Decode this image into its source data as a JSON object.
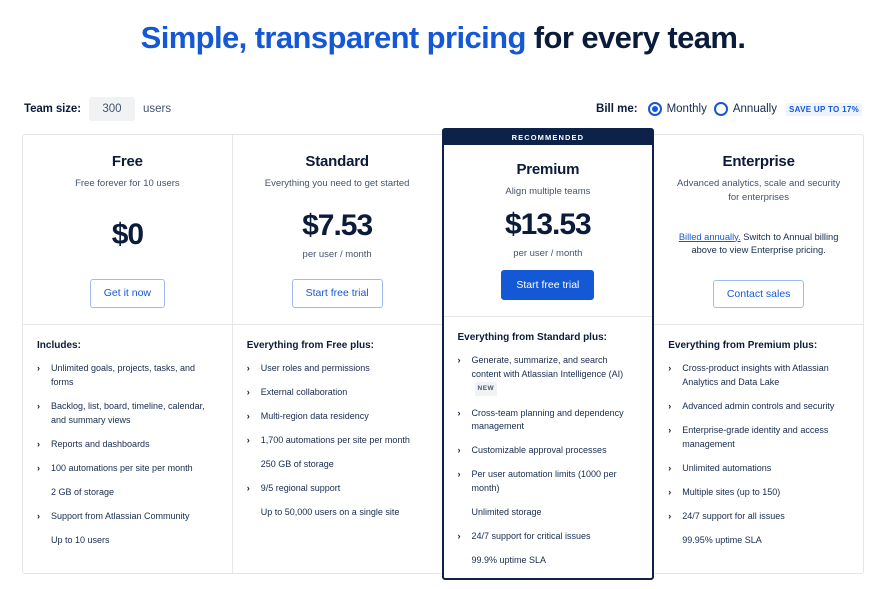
{
  "hero": {
    "accent_text": "Simple, transparent pricing",
    "rest_text": " for every team."
  },
  "controls": {
    "team_size_label": "Team size:",
    "team_size_value": "300",
    "team_size_placeholder": "300",
    "team_size_units": "users",
    "bill_me_label": "Bill me:",
    "monthly_label": "Monthly",
    "annually_label": "Annually",
    "save_badge": "SAVE UP TO 17%"
  },
  "colors": {
    "accent_blue": "#1558d6",
    "navy": "#0c2249",
    "border": "#e4e6ea",
    "muted_text": "#44546f"
  },
  "plans": [
    {
      "name": "Free",
      "tagline": "Free forever for 10 users",
      "price": "$0",
      "price_sub": "",
      "cta_label": "Get it now",
      "cta_style": "outline",
      "ribbon": "",
      "features_title": "Includes:",
      "features": [
        {
          "text": "Unlimited goals, projects, tasks, and forms",
          "chevron": true
        },
        {
          "text": "Backlog, list, board, timeline, calendar, and summary views",
          "chevron": true
        },
        {
          "text": "Reports and dashboards",
          "chevron": true
        },
        {
          "text": "100 automations per site per month",
          "chevron": true
        },
        {
          "text": "2 GB of storage",
          "chevron": false
        },
        {
          "text": "Support from Atlassian Community",
          "chevron": true
        },
        {
          "text": "Up to 10 users",
          "chevron": false
        }
      ]
    },
    {
      "name": "Standard",
      "tagline": "Everything you need to get started",
      "price": "$7.53",
      "price_sub": "per user / month",
      "cta_label": "Start free trial",
      "cta_style": "outline",
      "ribbon": "",
      "features_title": "Everything from Free plus:",
      "features": [
        {
          "text": "User roles and permissions",
          "chevron": true
        },
        {
          "text": "External collaboration",
          "chevron": true
        },
        {
          "text": "Multi-region data residency",
          "chevron": true
        },
        {
          "text": "1,700 automations per site per month",
          "chevron": true
        },
        {
          "text": "250 GB of storage",
          "chevron": false
        },
        {
          "text": "9/5 regional support",
          "chevron": true
        },
        {
          "text": "Up to 50,000 users on a single site",
          "chevron": false
        }
      ]
    },
    {
      "name": "Premium",
      "tagline": "Align multiple teams",
      "price": "$13.53",
      "price_sub": "per user / month",
      "cta_label": "Start free trial",
      "cta_style": "solid",
      "ribbon": "RECOMMENDED",
      "features_title": "Everything from Standard plus:",
      "features": [
        {
          "text": "Generate, summarize, and search content with Atlassian Intelligence (AI)",
          "chevron": true,
          "badge": "NEW"
        },
        {
          "text": "Cross-team planning and dependency management",
          "chevron": true
        },
        {
          "text": "Customizable approval processes",
          "chevron": true
        },
        {
          "text": "Per user automation limits (1000 per month)",
          "chevron": true
        },
        {
          "text": "Unlimited storage",
          "chevron": false
        },
        {
          "text": "24/7 support for critical issues",
          "chevron": true
        },
        {
          "text": "99.9% uptime SLA",
          "chevron": false
        }
      ]
    },
    {
      "name": "Enterprise",
      "tagline": "Advanced analytics, scale and security for enterprises",
      "price": "",
      "price_sub": "",
      "billed_link": "Billed annually.",
      "billed_note": " Switch to Annual billing above to view Enterprise pricing.",
      "cta_label": "Contact sales",
      "cta_style": "outline",
      "ribbon": "",
      "features_title": "Everything from Premium plus:",
      "features": [
        {
          "text": "Cross-product insights with Atlassian Analytics and Data Lake",
          "chevron": true
        },
        {
          "text": "Advanced admin controls and security",
          "chevron": true
        },
        {
          "text": "Enterprise-grade identity and access management",
          "chevron": true
        },
        {
          "text": "Unlimited automations",
          "chevron": true
        },
        {
          "text": "Multiple sites (up to 150)",
          "chevron": true
        },
        {
          "text": "24/7 support for all issues",
          "chevron": true
        },
        {
          "text": "99.95% uptime SLA",
          "chevron": false
        }
      ]
    }
  ],
  "icons": {
    "chevron_right": "›"
  }
}
